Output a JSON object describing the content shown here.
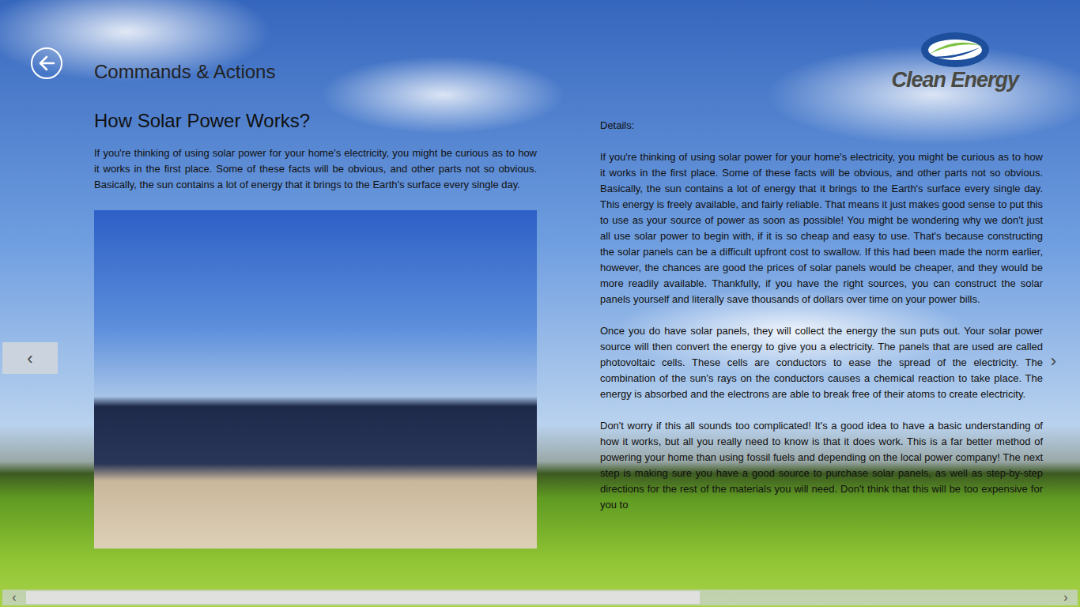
{
  "app": {
    "title": "Commands & Actions",
    "logo": "Clean Energy"
  },
  "article": {
    "heading": "How Solar Power Works?",
    "intro": "If you're thinking of using solar power for your home's electricity, you might be curious as to how it works in the first place. Some of these facts will be obvious, and other parts not so obvious. Basically, the sun contains a lot of energy that it brings to the Earth's surface every single day."
  },
  "details": {
    "label": "Details:",
    "paragraphs": [
      "If you're thinking of using solar power for your home's electricity, you might be curious as to how it works in the first place. Some of these facts will be obvious, and other parts not so obvious. Basically, the sun contains a lot of energy that it brings to the Earth's surface every single day. This energy is freely available, and fairly reliable. That means it just makes good sense to put this to use as your source of power as soon as possible! You might be wondering why we don't just all use solar power to begin with, if it is so cheap and easy to use. That's because constructing the solar panels can be a difficult upfront cost to swallow. If this had been made the norm earlier, however, the chances are good the prices of solar panels would be cheaper, and they would be more readily available. Thankfully, if you have the right sources, you can construct the solar panels yourself and literally save thousands of dollars over time on your power bills.",
      "Once you do have solar panels, they will collect the energy the sun puts out. Your solar power source will then convert the energy to give you a electricity. The panels that are used are called photovoltaic cells. These cells are conductors to ease the spread of the electricity. The combination of the sun's rays on the conductors causes a chemical reaction to take place. The energy is absorbed and the electrons are able to break free of their atoms to create electricity.",
      "Don't worry if this all sounds too complicated! It's a good idea to have a basic understanding of how it works, but all you really need to know is that it does work. This is a far better method of powering your home than using fossil fuels and depending on the local power company! The next step is making sure you have a good source to purchase solar panels, as well as step-by-step directions for the rest of the materials you will need. Don't think that this will be too expensive for you to"
    ]
  },
  "nav": {
    "prev": "‹",
    "next": "›"
  },
  "scrollbar": {
    "left": "‹",
    "right": "›",
    "level": 0.655
  }
}
